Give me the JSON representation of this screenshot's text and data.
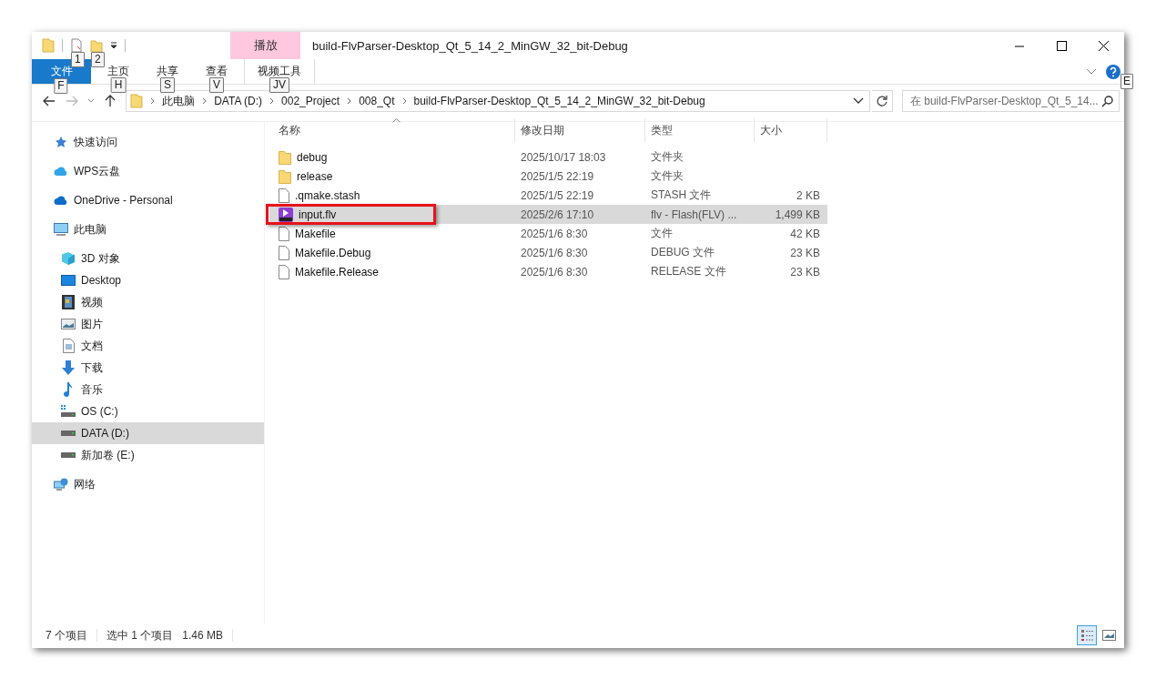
{
  "quick_access_toolbar": {
    "keytips": [
      "1",
      "2"
    ]
  },
  "contextual_tab_group": {
    "label": "播放"
  },
  "window": {
    "title": "build-FlvParser-Desktop_Qt_5_14_2_MinGW_32_bit-Debug"
  },
  "ribbon_tabs": [
    {
      "label": "文件",
      "keytip": "F",
      "kind": "file"
    },
    {
      "label": "主页",
      "keytip": "H",
      "kind": "tab"
    },
    {
      "label": "共享",
      "keytip": "S",
      "kind": "tab"
    },
    {
      "label": "查看",
      "keytip": "V",
      "kind": "tab"
    },
    {
      "label": "视频工具",
      "keytip": "JV",
      "kind": "contextual"
    }
  ],
  "help_keytip": "E",
  "address_bar": {
    "segments": [
      "此电脑",
      "DATA (D:)",
      "002_Project",
      "008_Qt",
      "build-FlvParser-Desktop_Qt_5_14_2_MinGW_32_bit-Debug"
    ]
  },
  "search": {
    "placeholder": "在 build-FlvParser-Desktop_Qt_5_14..."
  },
  "sidebar": {
    "items": [
      {
        "label": "快速访问",
        "kind": "star",
        "selected": false
      },
      {
        "label": "WPS云盘",
        "kind": "wps-cloud",
        "selected": false
      },
      {
        "label": "OneDrive - Personal",
        "kind": "onedrive",
        "selected": false
      },
      {
        "label": "此电脑",
        "kind": "pc",
        "selected": false,
        "children": [
          {
            "label": "3D 对象",
            "kind": "cube",
            "selected": false
          },
          {
            "label": "Desktop",
            "kind": "desktop",
            "selected": false
          },
          {
            "label": "视频",
            "kind": "video",
            "selected": false
          },
          {
            "label": "图片",
            "kind": "pictures",
            "selected": false
          },
          {
            "label": "文档",
            "kind": "documents",
            "selected": false
          },
          {
            "label": "下载",
            "kind": "downloads",
            "selected": false
          },
          {
            "label": "音乐",
            "kind": "music",
            "selected": false
          },
          {
            "label": "OS (C:)",
            "kind": "os-drive",
            "selected": false
          },
          {
            "label": "DATA (D:)",
            "kind": "drive",
            "selected": true
          },
          {
            "label": "新加卷 (E:)",
            "kind": "drive",
            "selected": false
          }
        ]
      },
      {
        "label": "网络",
        "kind": "network",
        "selected": false
      }
    ]
  },
  "table": {
    "columns": [
      {
        "label": "名称",
        "sorted": true
      },
      {
        "label": "修改日期",
        "sorted": false
      },
      {
        "label": "类型",
        "sorted": false
      },
      {
        "label": "大小",
        "sorted": false
      }
    ],
    "rows": [
      {
        "name": "debug",
        "modified": "2025/10/17 18:03",
        "type": "文件夹",
        "size": "",
        "kind": "folder",
        "selected": false,
        "annotated": false
      },
      {
        "name": "release",
        "modified": "2025/1/5 22:19",
        "type": "文件夹",
        "size": "",
        "kind": "folder",
        "selected": false,
        "annotated": false
      },
      {
        "name": ".qmake.stash",
        "modified": "2025/1/5 22:19",
        "type": "STASH 文件",
        "size": "2 KB",
        "kind": "file",
        "selected": false,
        "annotated": false
      },
      {
        "name": "input.flv",
        "modified": "2025/2/6 17:10",
        "type": "flv - Flash(FLV) ...",
        "size": "1,499 KB",
        "kind": "flv",
        "selected": true,
        "annotated": true
      },
      {
        "name": "Makefile",
        "modified": "2025/1/6 8:30",
        "type": "文件",
        "size": "42 KB",
        "kind": "file",
        "selected": false,
        "annotated": false
      },
      {
        "name": "Makefile.Debug",
        "modified": "2025/1/6 8:30",
        "type": "DEBUG 文件",
        "size": "23 KB",
        "kind": "file",
        "selected": false,
        "annotated": false
      },
      {
        "name": "Makefile.Release",
        "modified": "2025/1/6 8:30",
        "type": "RELEASE 文件",
        "size": "23 KB",
        "kind": "file",
        "selected": false,
        "annotated": false
      }
    ]
  },
  "status_bar": {
    "item_count": "7 个项目",
    "selection": "选中 1 个项目",
    "size": "1.46 MB",
    "view_buttons": [
      {
        "kind": "details",
        "selected": true
      },
      {
        "kind": "large-icons",
        "selected": false
      }
    ]
  }
}
